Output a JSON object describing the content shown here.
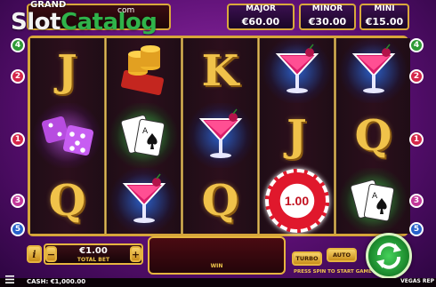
{
  "header": {
    "grand_label": "GRAND",
    "logo_left": "Slot",
    "logo_right": "Catalog",
    "logo_suffix": "com",
    "jackpots": [
      {
        "label": "MAJOR",
        "value": "€60.00"
      },
      {
        "label": "MINOR",
        "value": "€30.00"
      },
      {
        "label": "MINI",
        "value": "€15.00"
      }
    ]
  },
  "reels": [
    [
      "J",
      "dice",
      "Q"
    ],
    [
      "coins",
      "cards",
      "cocktail"
    ],
    [
      "K",
      "cocktail",
      "Q"
    ],
    [
      "cocktail",
      "J",
      "chip"
    ],
    [
      "cocktail",
      "Q",
      "cards"
    ]
  ],
  "chip_value": "1.00",
  "line_markers": {
    "left": [
      "4",
      "2",
      "1",
      "3",
      "5"
    ],
    "right": [
      "4",
      "2",
      "1",
      "3",
      "5"
    ],
    "colors": {
      "1": "#d4264a",
      "2": "#d4264a",
      "3": "#c2369a",
      "4": "#2f9a37",
      "5": "#2660c9"
    }
  },
  "controls": {
    "info_label": "i",
    "minus_label": "−",
    "plus_label": "+",
    "bet_value": "€1.00",
    "bet_label": "TOTAL BET",
    "win_label": "WIN",
    "turbo_label": "TURBO",
    "auto_label": "AUTO",
    "press_spin": "PRESS SPIN TO START GAME"
  },
  "footer": {
    "cash_text": "CASH: €1,000.00",
    "brand_text": "VEGAS REP"
  },
  "colors": {
    "gold": "#e6b53f",
    "background": "#7a1f93",
    "spin_green": "#2fb34a"
  }
}
